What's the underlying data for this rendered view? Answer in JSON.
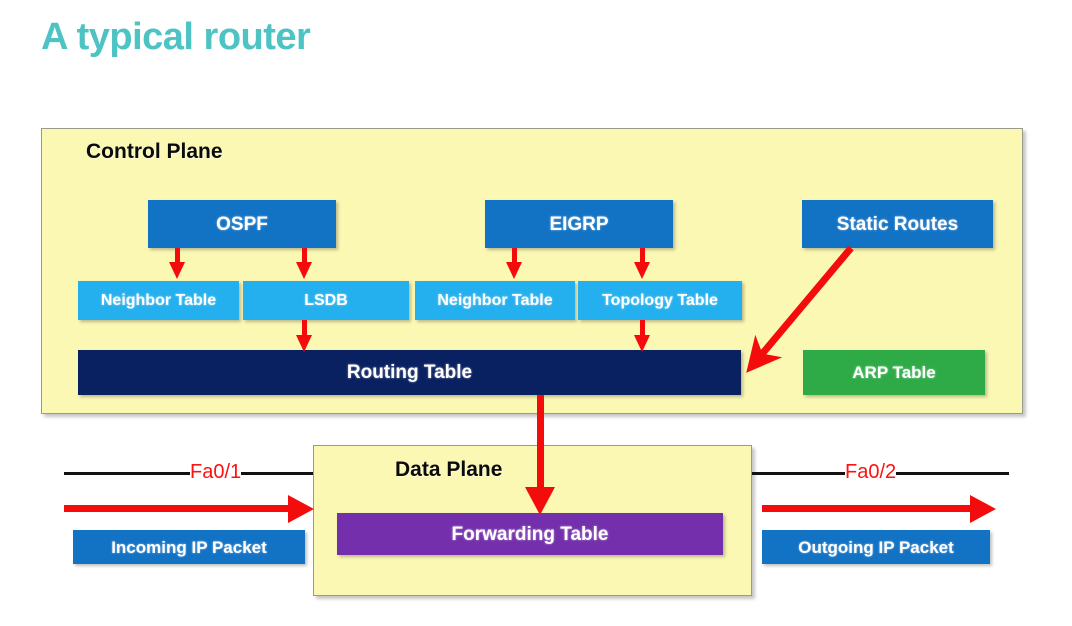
{
  "page": {
    "title": "A typical router",
    "title_color": "#4ec3c4",
    "background": "#ffffff"
  },
  "control_plane": {
    "label": "Control Plane",
    "background": "#fbf8b4",
    "protocols": [
      {
        "label": "OSPF",
        "color": "#1272c4"
      },
      {
        "label": "EIGRP",
        "color": "#1272c4"
      },
      {
        "label": "Static Routes",
        "color": "#1272c4"
      }
    ],
    "sub_tables": [
      {
        "label": "Neighbor Table",
        "color": "#24b0ee",
        "parent": "OSPF"
      },
      {
        "label": "LSDB",
        "color": "#24b0ee",
        "parent": "OSPF"
      },
      {
        "label": "Neighbor Table",
        "color": "#24b0ee",
        "parent": "EIGRP"
      },
      {
        "label": "Topology Table",
        "color": "#24b0ee",
        "parent": "EIGRP"
      }
    ],
    "routing_table": {
      "label": "Routing Table",
      "color": "#0a2161"
    },
    "arp_table": {
      "label": "ARP Table",
      "color": "#2eab47"
    }
  },
  "data_plane": {
    "label": "Data Plane",
    "background": "#fbf8b4",
    "forwarding_table": {
      "label": "Forwarding Table",
      "color": "#7430ac"
    }
  },
  "interfaces": {
    "left": {
      "label": "Fa0/1",
      "color": "#ff1111"
    },
    "right": {
      "label": "Fa0/2",
      "color": "#ff1111"
    }
  },
  "packets": {
    "incoming": {
      "label": "Incoming IP Packet",
      "color": "#1272c4"
    },
    "outgoing": {
      "label": "Outgoing IP Packet",
      "color": "#1272c4"
    }
  },
  "arrows": {
    "color": "#f40b0b",
    "flows": [
      "OSPF to Neighbor Table",
      "OSPF to LSDB",
      "EIGRP to Neighbor Table",
      "EIGRP to Topology Table",
      "LSDB to Routing Table",
      "Topology Table to Routing Table",
      "Static Routes to Routing Table",
      "Routing Table to Forwarding Table",
      "Incoming IP Packet into Data Plane",
      "Outgoing IP Packet out of Data Plane"
    ]
  }
}
